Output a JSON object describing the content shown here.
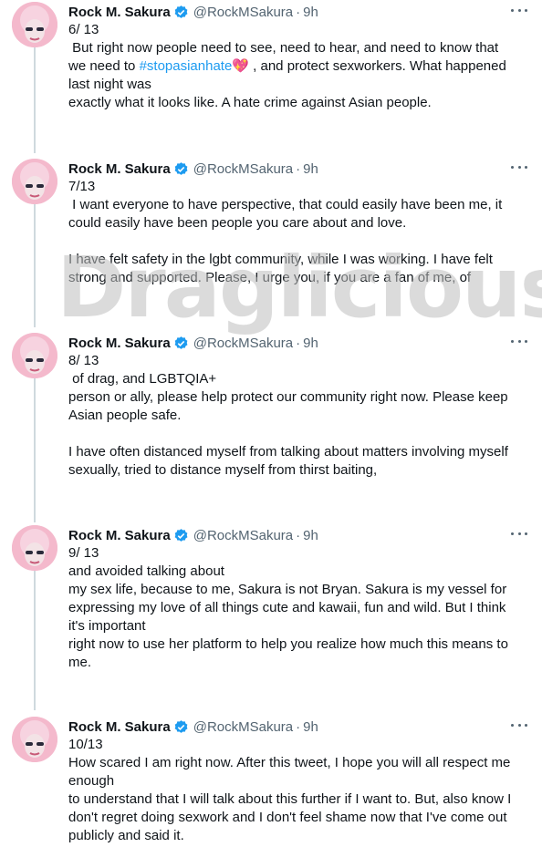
{
  "author": {
    "name": "Rock M. Sakura",
    "handle": "@RockMSakura",
    "time": "9h"
  },
  "tweets": [
    {
      "counter": "6/ 13",
      "text_before": " But right now people need to see, need to hear, and need to know that\nwe need to ",
      "hashtag": "#stopasianhate",
      "emoji": "💖",
      "text_after": " , and protect sexworkers. What happened\nlast night was\nexactly what it looks like. A hate crime against Asian people."
    },
    {
      "counter": "7/13",
      "text": " I want everyone to have perspective, that could easily have been me, it\ncould easily have been people you care about and love.\n\nI have felt safety in the lgbt community, while I was working. I have felt\nstrong and supported. Please, I urge you, if you are a fan of me, of"
    },
    {
      "counter": "8/ 13",
      "text": " of drag, and LGBTQIA+\nperson or ally, please help protect our community right now. Please keep\nAsian people safe.\n\nI have often distanced myself from talking about matters involving myself\nsexually, tried to distance myself from thirst baiting,"
    },
    {
      "counter": "9/ 13",
      "text": "and avoided talking about\nmy sex life, because to me, Sakura is not Bryan. Sakura is my vessel for\nexpressing my love of all things cute and kawaii, fun and wild. But I think\nit's important\nright now to use her platform to help you realize how much this means to\nme."
    },
    {
      "counter": "10/13",
      "text": "How scared I am right now. After this tweet, I hope you will all respect me\nenough\nto understand that I will talk about this further if I want to. But, also know I\ndon't regret doing sexwork and I don't feel shame now that I've come out\npublicly and said it."
    }
  ],
  "watermark": "Draglicious",
  "colors": {
    "link": "#1d9bf0",
    "verified": "#1d9bf0",
    "secondary_text": "#536471",
    "thread_line": "#cfd9de"
  }
}
